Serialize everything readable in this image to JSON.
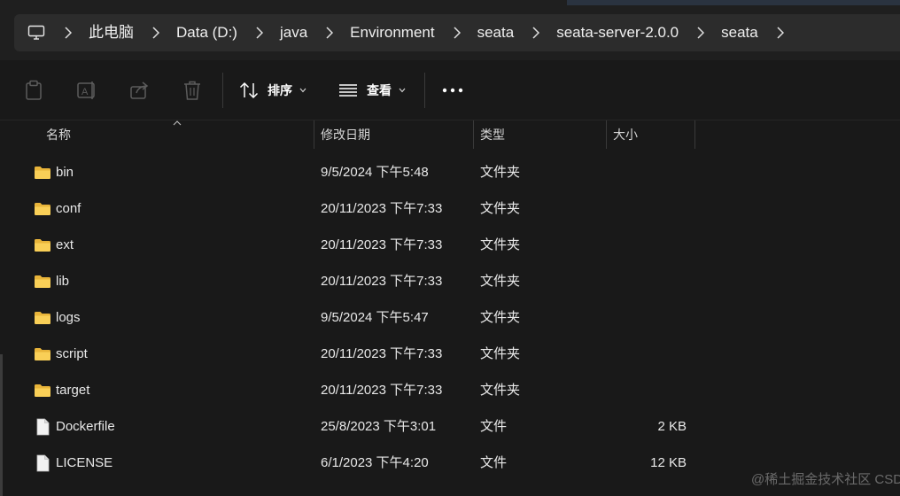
{
  "breadcrumb": {
    "root_icon": "computer-icon",
    "items": [
      {
        "label": "此电脑"
      },
      {
        "label": "Data (D:)"
      },
      {
        "label": "java"
      },
      {
        "label": "Environment"
      },
      {
        "label": "seata"
      },
      {
        "label": "seata-server-2.0.0"
      },
      {
        "label": "seata"
      }
    ]
  },
  "toolbar": {
    "copy_icon": "clipboard-icon",
    "rename_icon": "rename-icon",
    "share_icon": "share-icon",
    "delete_icon": "trash-icon",
    "sort_label": "排序",
    "view_label": "查看",
    "more_icon": "more-icon"
  },
  "columns": {
    "name": "名称",
    "modified": "修改日期",
    "type": "类型",
    "size": "大小"
  },
  "files": [
    {
      "name": "bin",
      "modified": "9/5/2024 下午5:48",
      "type": "文件夹",
      "size": "",
      "kind": "folder"
    },
    {
      "name": "conf",
      "modified": "20/11/2023 下午7:33",
      "type": "文件夹",
      "size": "",
      "kind": "folder"
    },
    {
      "name": "ext",
      "modified": "20/11/2023 下午7:33",
      "type": "文件夹",
      "size": "",
      "kind": "folder"
    },
    {
      "name": "lib",
      "modified": "20/11/2023 下午7:33",
      "type": "文件夹",
      "size": "",
      "kind": "folder"
    },
    {
      "name": "logs",
      "modified": "9/5/2024 下午5:47",
      "type": "文件夹",
      "size": "",
      "kind": "folder"
    },
    {
      "name": "script",
      "modified": "20/11/2023 下午7:33",
      "type": "文件夹",
      "size": "",
      "kind": "folder"
    },
    {
      "name": "target",
      "modified": "20/11/2023 下午7:33",
      "type": "文件夹",
      "size": "",
      "kind": "folder"
    },
    {
      "name": "Dockerfile",
      "modified": "25/8/2023 下午3:01",
      "type": "文件",
      "size": "2 KB",
      "kind": "file"
    },
    {
      "name": "LICENSE",
      "modified": "6/1/2023 下午4:20",
      "type": "文件",
      "size": "12 KB",
      "kind": "file"
    }
  ],
  "watermark": "@稀土掘金技术社区 CSDN @Gary_Tam",
  "colors": {
    "folder": "#f4c44e",
    "background": "#191919",
    "address_bar": "#2c2c2c"
  }
}
